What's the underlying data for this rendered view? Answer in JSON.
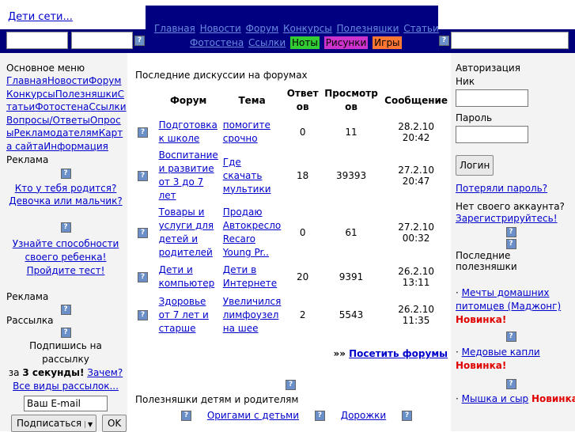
{
  "site": {
    "brand": "Дети сети..."
  },
  "nav": {
    "row1": [
      "Главная",
      "Новости",
      "Форум",
      "Конкурсы",
      "Полезняшки",
      "Статьи"
    ],
    "row2": [
      "Фотостена",
      "Ссылки"
    ],
    "highlight": [
      {
        "label": "Ноты",
        "color": "#33cc33"
      },
      {
        "label": "Рисунки",
        "color": "#cc33cc"
      },
      {
        "label": "Игры",
        "color": "#ff7733"
      }
    ]
  },
  "left": {
    "menu_title": "Основное меню",
    "menu_links": [
      "Главная",
      "Новости",
      "Форум",
      "Конкурсы",
      "Полезняшки",
      "Статьи",
      "Фотостена",
      "Ссылки",
      "Вопросы/Ответы",
      "Опросы",
      "Рекламодателям",
      "Карта сайта",
      "Информация"
    ],
    "ads_title": "Реклама",
    "ad1": {
      "line1": "Кто у тебя родится?",
      "line2": "Девочка или мальчик?"
    },
    "ad2": {
      "line1": "Узнайте способности",
      "line2": "своего ребенка!",
      "line3": "Пройдите тест!"
    },
    "ads_title2": "Реклама",
    "mailing_title": "Рассылка",
    "subscribe_prefix": "Подпишись на рассылку",
    "subscribe_mid": "за",
    "subscribe_bold": "3 секунды!",
    "why_link": "Зачем?",
    "all_link": "Все виды рассылок...",
    "email_value": "Ваш E-mail",
    "select_value": "Подписаться",
    "ok_label": "OK"
  },
  "forum": {
    "title": "Последние дискуссии на форумах",
    "headers": {
      "forum": "Форум",
      "topic": "Тема",
      "answers": "Ответов",
      "views": "Просмотров",
      "message": "Сообщение"
    },
    "rows": [
      {
        "forum": "Подготовка к школе",
        "topic": "помогите срочно",
        "answers": "0",
        "views": "11",
        "date": "28.2.10 20:42"
      },
      {
        "forum": "Воспитание и развитие от 3 до 7 лет",
        "topic": "Где скачать мультики",
        "answers": "18",
        "views": "39393",
        "date": "27.2.10 20:47"
      },
      {
        "forum": "Товары и услуги для детей и родителей",
        "topic": "Продаю Автокресло Recaro Young Pr..",
        "answers": "0",
        "views": "61",
        "date": "27.2.10 00:32"
      },
      {
        "forum": "Дети и компьютер",
        "topic": "Дети в Интернете",
        "answers": "20",
        "views": "9391",
        "date": "26.2.10 13:11"
      },
      {
        "forum": "Здоровье от 7 лет и старше",
        "topic": "Увеличился лимфоузел на шее",
        "answers": "2",
        "views": "5543",
        "date": "26.2.10 11:35"
      }
    ],
    "visit_prefix": "»»",
    "visit_link": "Посетить форумы"
  },
  "useful": {
    "title": "Полезняшки детям и родителям",
    "items": [
      "Оригами с детьми",
      "Дорожки"
    ]
  },
  "right": {
    "auth_title": "Авторизация",
    "nick_label": "Ник",
    "pass_label": "Пароль",
    "login_btn": "Логин",
    "lost_link": "Потеряли пароль?",
    "no_account": "Нет своего аккаунта?",
    "register_link": "Зарегистрируйтесь!",
    "latest_title": "Последние полезняшки",
    "latest": [
      {
        "text": "Мечты домашних питомцев (Маджонг)",
        "badge": "Новинка!"
      },
      {
        "text": "Медовые капли",
        "badge": "Новинка!"
      },
      {
        "text": "Мышка и сыр",
        "badge": "Новинка"
      }
    ]
  }
}
